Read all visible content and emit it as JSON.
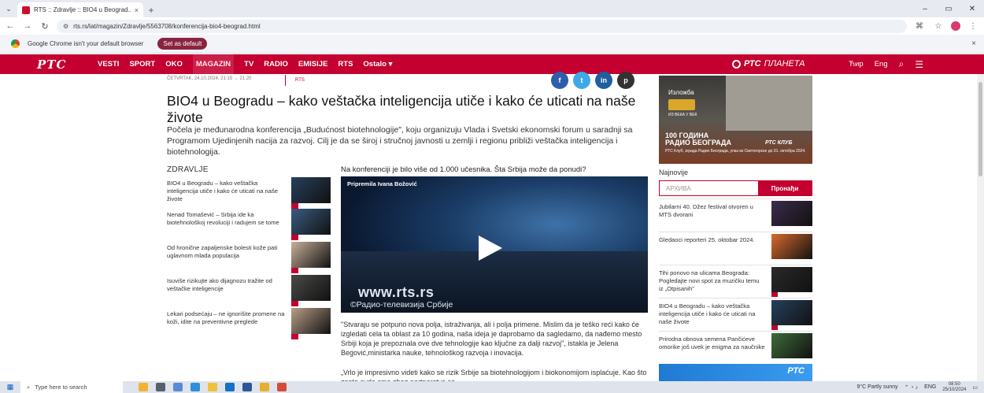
{
  "browser": {
    "tab_title": "RTS :: Zdravlje :: BIO4 u Beograd...",
    "tab_close": "×",
    "new_tab": "+",
    "window_controls": [
      "–",
      "▭",
      "✕"
    ],
    "url": "rts.rs/lat/magazin/Zdravlje/5563708/konferencija-bio4-beograd.html",
    "icons": [
      "back-icon",
      "forward-icon",
      "reload-icon",
      "tune-icon",
      "translate-icon",
      "star-icon",
      "menu-icon"
    ],
    "infobar_text": "Google Chrome isn't your default browser",
    "infobar_button": "Set as default",
    "infobar_close": "×"
  },
  "rts_nav": {
    "logo": "РТС",
    "items": [
      "VESTI",
      "SPORT",
      "OKO",
      "MAGAZIN",
      "TV",
      "RADIO",
      "EMISIJE",
      "RTS",
      "Ostalo ▾"
    ],
    "active": "MAGAZIN",
    "planeta_brand": "РТС",
    "planeta_word": "ПЛАНЕТА",
    "script_toggle": "Ћир",
    "lang": "Eng",
    "accent": "#c3002f"
  },
  "article": {
    "dateline": "ČETVRTAK, 24.10.2024, 21:15 → 21:20",
    "source": "RTS",
    "share_buttons": [
      "f",
      "t",
      "in",
      "p"
    ],
    "headline": "BIO4 u Beogradu – kako veštačka inteligencija utiče i kako će uticati na naše živote",
    "lead": "Počela je međunarodna konferencija „Budućnost biotehnologije\", koju organizuju Vlada i Svetski ekonomski forum u saradnji sa Programom Ujedinjenih nacija za razvoj. Cilj je da se široj i stručnoj javnosti u zemlji i regionu približi veštačka inteligencija i biotehnologija.",
    "question": "Na konferenciji je bilo više od 1.000 učesnika. Šta Srbija može da ponudi?",
    "video_credit": "Pripremila Ivana Božović",
    "video_watermark_1": "www.rts.rs",
    "video_watermark_2": "©Радио-телевизија Србије",
    "body_1": "\"Stvaraju se potpuno nova polja, istraživanja, ali i polja primene. Mislim da je teško reći kako će izgledati cela ta oblast za 10 godina, naša ideja je daprobamo da sagledamo, da nađemo mesto Srbiji koja je prepoznala ove dve tehnologije kao ključne za dalji razvoj\", istakla je Jelena Begović,ministarka nauke, tehnološkog razvoja i inovacija.",
    "body_2": "„Vrlo je impresivno videti kako se rizik Srbije sa biotehnologijom i biokonomijom isplaćuje. Kao što znate ovde smo zbog partnerstva sa"
  },
  "related": {
    "section": "ZDRAVLJE",
    "items": [
      {
        "title": "BIO4 u Beogradu – kako veštačka inteligencija utiče i kako će uticati na naše živote",
        "thumb": "#27405e"
      },
      {
        "title": "Nenad Tomašević – Srbija ide ka biotehnološkoj revoluciji i radujem se tome",
        "thumb": "#3a5c82"
      },
      {
        "title": "Od hronične zapaljenske bolesti kože pati uglavnom mlada populacija",
        "thumb": "#c8b09a"
      },
      {
        "title": "Isuviše rizikujte ako dijagnozu tražite od veštačke inteligencije",
        "thumb": "#4a4a48"
      },
      {
        "title": "Lekari podsećaju – ne ignorišite promene na koži, idite na preventivne preglede",
        "thumb": "#b89f88"
      }
    ]
  },
  "sidebar": {
    "ad": {
      "line1": "Изложба",
      "line2": "ИЗ ВЕКА У ВЕК",
      "line3a": "100 ГОДИНА",
      "line3b": "РАДИО БЕОГРАДА",
      "brand": "РТС КЛУБ",
      "footer": "РТС Клуб, зграда Радио Београда, улаз из Светогорске до 31. октобра 2024."
    },
    "latest_label": "Najnovije",
    "archive_placeholder": "АРХИВА",
    "archive_button": "Пронађи",
    "news": [
      {
        "title": "Jubilarni 40. Džez festival otvoren u MTS dvorani",
        "img": "#3c2c4c",
        "video": false
      },
      {
        "title": "Gledaoci reporteri 25. oktobar 2024.",
        "img": "#d86a2e",
        "video": false
      },
      {
        "title": "Tihi ponovo na ulicama Beograda: Pogledajte novi spot za muzičku temu iz „Otpisanih\"",
        "img": "#2a2a2a",
        "video": true
      },
      {
        "title": "BIO4 u Beogradu – kako veštačka inteligencija utiče i kako će uticati na naše živote",
        "img": "#27405e",
        "video": true
      },
      {
        "title": "Prirodna obnova semena Pančićeve omorike još uvek je enigma za naučnike",
        "img": "#3f6b3a",
        "video": false
      }
    ],
    "ad_bottom": "РТС"
  },
  "taskbar": {
    "search_placeholder": "Type here to search",
    "weather": "9°C  Partly sunny",
    "lang": "ENG",
    "time": "08:50",
    "date": "25/10/2024"
  }
}
